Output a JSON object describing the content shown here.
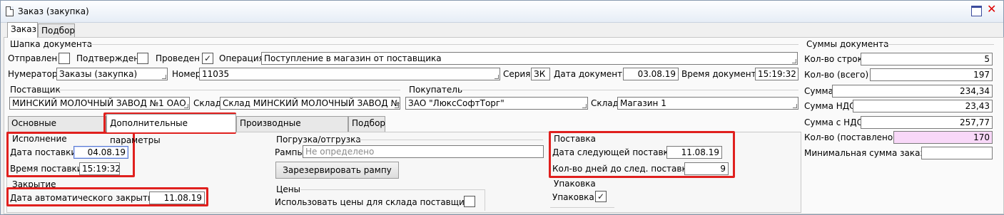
{
  "window": {
    "title": "Заказ (закупка)"
  },
  "top_tabs": [
    "Заказ",
    "Подбор"
  ],
  "header_group": {
    "title": "Шапка документа",
    "sent_label": "Отправлен",
    "sent_checked": false,
    "confirmed_label": "Подтвержден",
    "confirmed_checked": false,
    "posted_label": "Проведен",
    "posted_checked": true,
    "posted_mark": "✓",
    "operation_label": "Операция",
    "operation_value": "Поступление в магазин от поставщика",
    "numerator_label": "Нумератор",
    "numerator_value": "Заказы (закупка)",
    "number_label": "Номер",
    "number_value": "11035",
    "series_label": "Серия",
    "series_value": "ЗК",
    "doc_date_label": "Дата документа",
    "doc_date_value": "03.08.19",
    "doc_time_label": "Время документа",
    "doc_time_value": "15:19:32"
  },
  "supplier": {
    "title": "Поставщик",
    "value": "МИНСКИЙ МОЛОЧНЫЙ ЗАВОД №1 ОАО",
    "warehouse_label": "Склад",
    "warehouse_value": "Склад МИНСКИЙ МОЛОЧНЫЙ ЗАВОД №..."
  },
  "buyer": {
    "title": "Покупатель",
    "value": "ЗАО \"ЛюксСофтТорг\"",
    "warehouse_label": "Склад",
    "warehouse_value": "Магазин 1"
  },
  "inner_tabs": [
    "Основные параметры",
    "Дополнительные параметры",
    "Производные документы",
    "Подбор"
  ],
  "execution": {
    "title": "Исполнение",
    "delivery_date_label": "Дата поставки",
    "delivery_date_value": "04.08.19",
    "delivery_time_label": "Время поставки",
    "delivery_time_value": "15:19:32"
  },
  "closing": {
    "title": "Закрытие",
    "auto_close_label": "Дата автоматического закрытия",
    "auto_close_value": "11.08.19"
  },
  "loading": {
    "title": "Погрузка/отгрузка",
    "ramps_label": "Рампы",
    "ramps_placeholder": "Не определено",
    "reserve_button": "Зарезервировать рампу"
  },
  "prices": {
    "title": "Цены",
    "use_supplier_prices_label": "Использовать цены для склада поставщика",
    "use_supplier_prices_checked": false
  },
  "delivery": {
    "title": "Поставка",
    "next_delivery_label": "Дата следующей поставки",
    "next_delivery_value": "11.08.19",
    "days_to_next_label": "Кол-во дней до след. поставки",
    "days_to_next_value": "9"
  },
  "packaging": {
    "title": "Упаковка",
    "label": "Упаковка",
    "checked": true,
    "mark": "✓"
  },
  "totals": {
    "title": "Суммы документа",
    "rows": [
      {
        "label": "Кол-во строк",
        "value": "5"
      },
      {
        "label": "Кол-во (всего)",
        "value": "197"
      },
      {
        "label": "Сумма",
        "value": "234,34"
      },
      {
        "label": "Сумма НДС",
        "value": "23,43"
      },
      {
        "label": "Сумма с НДС",
        "value": "257,77"
      },
      {
        "label": "Кол-во (поставлено)",
        "value": "170"
      },
      {
        "label": "Минимальная сумма заказа",
        "value": ""
      }
    ]
  },
  "colors": {
    "highlight": "#e0201e",
    "delivered_bg": "#f8d8f8"
  }
}
